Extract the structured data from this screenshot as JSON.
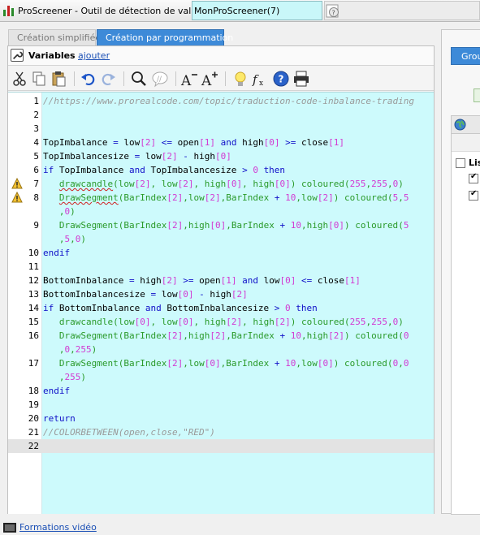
{
  "window": {
    "title": "ProScreener - Outil de détection de valeurs",
    "screener_name": "MonProScreener(7)"
  },
  "tabs": [
    {
      "label": "Création simplifiée",
      "active": false
    },
    {
      "label": "Création par programmation",
      "active": true
    }
  ],
  "variables": {
    "label": "Variables",
    "add_link": "ajouter"
  },
  "toolbar": {
    "icons": [
      "cut-icon",
      "copy-icon",
      "paste-icon",
      "undo-icon",
      "redo-icon",
      "search-icon",
      "comment-icon",
      "font-decrease-icon",
      "font-increase-icon",
      "idea-icon",
      "function-icon",
      "help-icon",
      "print-icon"
    ]
  },
  "code": {
    "lines": [
      {
        "n": "1",
        "text": "//https://www.prorealcode.com/topic/traduction-code-inbalance-trading"
      },
      {
        "n": "2",
        "text": ""
      },
      {
        "n": "3",
        "text": ""
      },
      {
        "n": "4",
        "text": "TopImbalance = low[2] <= open[1] and high[0] >= close[1]"
      },
      {
        "n": "5",
        "text": "TopImbalancesize = low[2] - high[0]"
      },
      {
        "n": "6",
        "text": "if TopImbalance and TopImbalancesize > 0 then"
      },
      {
        "n": "7",
        "text": "   drawcandle(low[2], low[2], high[0], high[0]) coloured(255,255,0)",
        "warning": true
      },
      {
        "n": "8",
        "text": "   DrawSegment(BarIndex[2],low[2],BarIndex + 10,low[2]) coloured(5,5",
        "warning": true
      },
      {
        "n": "",
        "text": "   ,0)"
      },
      {
        "n": "9",
        "text": "   DrawSegment(BarIndex[2],high[0],BarIndex + 10,high[0]) coloured(5"
      },
      {
        "n": "",
        "text": "   ,5,0)"
      },
      {
        "n": "10",
        "text": "endif"
      },
      {
        "n": "11",
        "text": ""
      },
      {
        "n": "12",
        "text": "BottomInbalance = high[2] >= open[1] and low[0] <= close[1]"
      },
      {
        "n": "13",
        "text": "BottomInbalancesize = low[0] - high[2]"
      },
      {
        "n": "14",
        "text": "if BottomInbalance and BottomInbalancesize > 0 then"
      },
      {
        "n": "15",
        "text": "   drawcandle(low[0], low[0], high[2], high[2]) coloured(255,255,0)"
      },
      {
        "n": "16",
        "text": "   DrawSegment(BarIndex[2],high[2],BarIndex + 10,high[2]) coloured(0"
      },
      {
        "n": "",
        "text": "   ,0,255)"
      },
      {
        "n": "17",
        "text": "   DrawSegment(BarIndex[2],low[0],BarIndex + 10,low[0]) coloured(0,0"
      },
      {
        "n": "",
        "text": "   ,255)"
      },
      {
        "n": "18",
        "text": "endif"
      },
      {
        "n": "19",
        "text": ""
      },
      {
        "n": "20",
        "text": "return"
      },
      {
        "n": "21",
        "text": "//COLORBETWEEN(open,close,\"RED\")"
      },
      {
        "n": "22",
        "text": "",
        "current": true
      }
    ]
  },
  "right_panel": {
    "button_label": "Grou",
    "list_label": "Lis"
  },
  "footer": {
    "link": "Formations vidéo"
  },
  "colors": {
    "accent": "#3d8ad8",
    "editor_bg": "#cdfafc",
    "keyword": "#1010c8",
    "number": "#d23ad2",
    "function": "#2a9a2a",
    "comment": "#9a9a9a"
  }
}
